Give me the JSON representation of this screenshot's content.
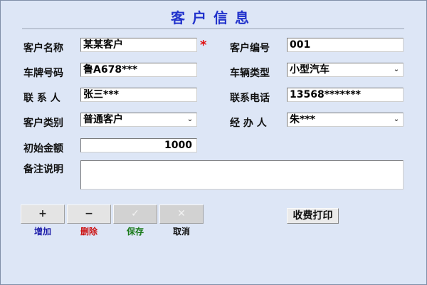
{
  "title": "客户信息",
  "required_mark": "*",
  "form": {
    "customer_name": {
      "label": "客户名称",
      "value": "某某客户"
    },
    "customer_no": {
      "label": "客户编号",
      "value": "001"
    },
    "plate_no": {
      "label": "车牌号码",
      "value": "鲁A678***"
    },
    "vehicle_type": {
      "label": "车辆类型",
      "value": "小型汽车"
    },
    "contact": {
      "label": "联 系 人",
      "value": "张三***"
    },
    "phone": {
      "label": "联系电话",
      "value": "13568*******"
    },
    "customer_type": {
      "label": "客户类别",
      "value": "普通客户"
    },
    "handler": {
      "label": "经 办 人",
      "value": "朱***"
    },
    "initial_amount": {
      "label": "初始金额",
      "value": "1000"
    },
    "notes": {
      "label": "备注说明",
      "value": ""
    }
  },
  "toolbar": {
    "add": {
      "icon": "+",
      "label": "增加",
      "color": "#1a1aa8"
    },
    "delete": {
      "icon": "−",
      "label": "删除",
      "color": "#cc1111"
    },
    "save": {
      "icon": "✓",
      "label": "保存",
      "color": "#1a7a1a"
    },
    "cancel": {
      "icon": "✕",
      "label": "取消",
      "color": "#111111"
    }
  },
  "print_button": {
    "label": "收费打印"
  },
  "colors": {
    "title": "#2233cc",
    "required": "#e01010",
    "background": "#dde6f6"
  }
}
